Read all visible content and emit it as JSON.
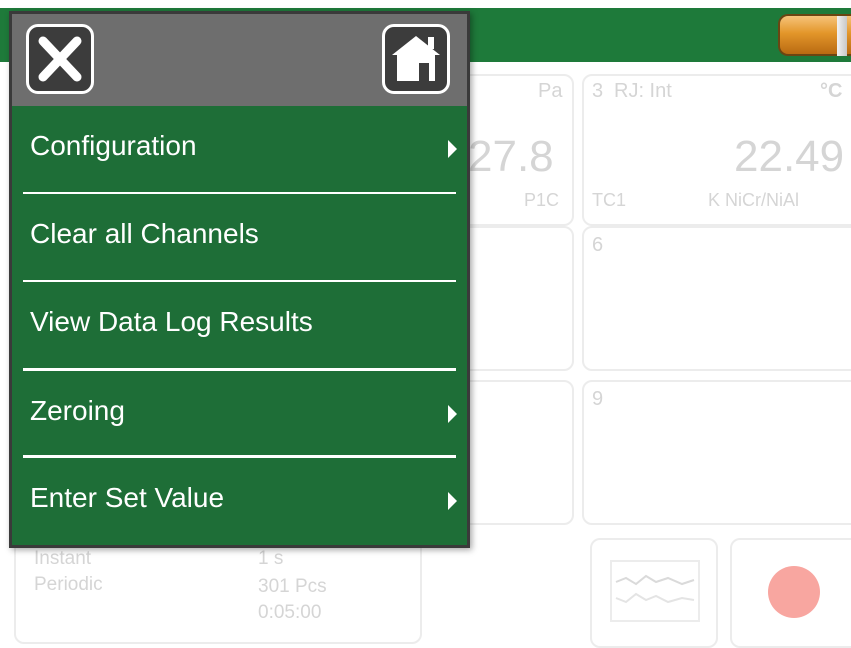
{
  "menu": {
    "items": [
      {
        "label": "Configuration",
        "submenu": true
      },
      {
        "label": "Clear all Channels",
        "submenu": false
      },
      {
        "label": "View Data Log Results",
        "submenu": false
      },
      {
        "label": "Zeroing",
        "submenu": true
      },
      {
        "label": "Enter Set Value",
        "submenu": true
      }
    ],
    "close_icon": "close-icon",
    "home_icon": "home-icon"
  },
  "background": {
    "channel1": {
      "unit": "Pa",
      "value": "27.8",
      "footer": "P1C"
    },
    "channel3": {
      "number": "3",
      "rj": "RJ: Int",
      "unit": "°C",
      "value": "22.49",
      "sensor": "TC1",
      "type": "K  NiCr/NiAl"
    },
    "channel6": {
      "number": "6"
    },
    "channel9": {
      "number": "9"
    },
    "log": {
      "label1": "Instant",
      "label2": "Periodic",
      "val1": "1 s",
      "val2": "301 Pcs",
      "val3": "0:05:00"
    }
  },
  "colors": {
    "topbar": "#1e7a3a",
    "menu_bg": "#1e6e37",
    "menu_header": "#6e6e6e"
  }
}
